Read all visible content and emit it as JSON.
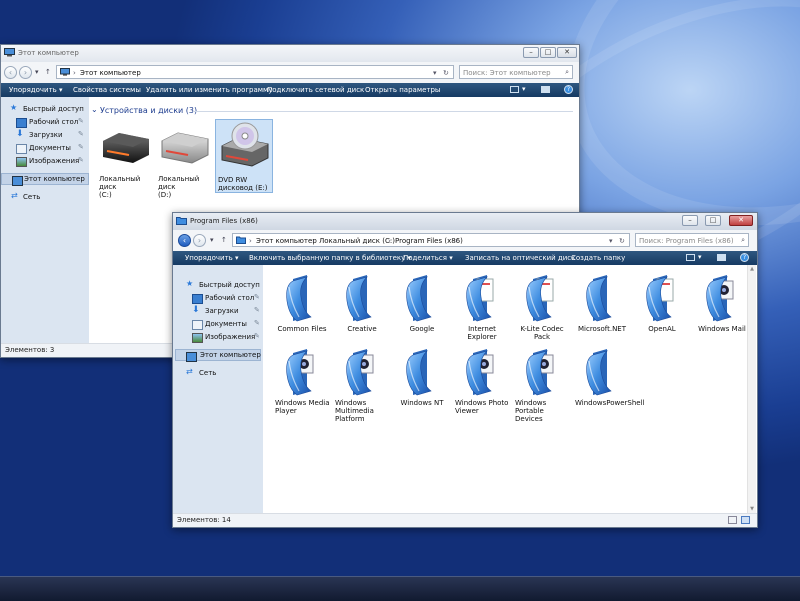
{
  "window_back": {
    "title": "Этот компьютер",
    "address": {
      "crumb": "Этот компьютер"
    },
    "search_placeholder": "Поиск: Этот компьютер",
    "commands": [
      "Упорядочить",
      "Свойства системы",
      "Удалить или изменить программу",
      "Подключить сетевой диск",
      "Открыть параметры"
    ],
    "nav": {
      "quick_access": "Быстрый доступ",
      "items": [
        "Рабочий стол",
        "Загрузки",
        "Документы",
        "Изображения"
      ],
      "this_pc": "Этот компьютер",
      "network": "Сеть"
    },
    "group_header": "Устройства и диски (3)",
    "drives": [
      {
        "label_line1": "Локальный диск",
        "label_line2": "(C:)",
        "icon": "hard-drive-icon"
      },
      {
        "label_line1": "Локальный диск",
        "label_line2": "(D:)",
        "icon": "hard-drive-icon"
      },
      {
        "label_line1": "DVD RW",
        "label_line2": "дисковод (E:)",
        "icon": "dvd-drive-icon"
      }
    ],
    "status": "Элементов: 3"
  },
  "window_front": {
    "title": "Program Files (x86)",
    "address": {
      "crumbs": [
        "Этот компьютер",
        "Локальный диск (C:)",
        "Program Files (x86)"
      ]
    },
    "search_placeholder": "Поиск: Program Files (x86)",
    "commands": [
      "Упорядочить",
      "Включить выбранную папку в библиотеку",
      "Поделиться",
      "Записать на оптический диск",
      "Создать папку"
    ],
    "nav": {
      "quick_access": "Быстрый доступ",
      "items": [
        "Рабочий стол",
        "Загрузки",
        "Документы",
        "Изображения"
      ],
      "this_pc": "Этот компьютер",
      "network": "Сеть"
    },
    "folders": [
      {
        "name": "Common Files",
        "badge": ""
      },
      {
        "name": "Creative",
        "badge": ""
      },
      {
        "name": "Google",
        "badge": ""
      },
      {
        "name": "Internet Explorer",
        "badge": "document"
      },
      {
        "name": "K-Lite Codec Pack",
        "badge": "document"
      },
      {
        "name": "Microsoft.NET",
        "badge": ""
      },
      {
        "name": "OpenAL",
        "badge": "document"
      },
      {
        "name": "Windows Mail",
        "badge": "media"
      },
      {
        "name": "Windows Media Player",
        "badge": "media"
      },
      {
        "name": "Windows Multimedia Platform",
        "badge": "media"
      },
      {
        "name": "Windows NT",
        "badge": ""
      },
      {
        "name": "Windows Photo Viewer",
        "badge": "media"
      },
      {
        "name": "Windows Portable Devices",
        "badge": "media"
      },
      {
        "name": "WindowsPowerShell",
        "badge": ""
      }
    ],
    "status": "Элементов: 14"
  },
  "colors": {
    "command_bar": "#1f4770",
    "nav_pane": "#dbe5f1",
    "folder_blue": "#3f8de0",
    "desktop_dark": "#1a3e92"
  }
}
